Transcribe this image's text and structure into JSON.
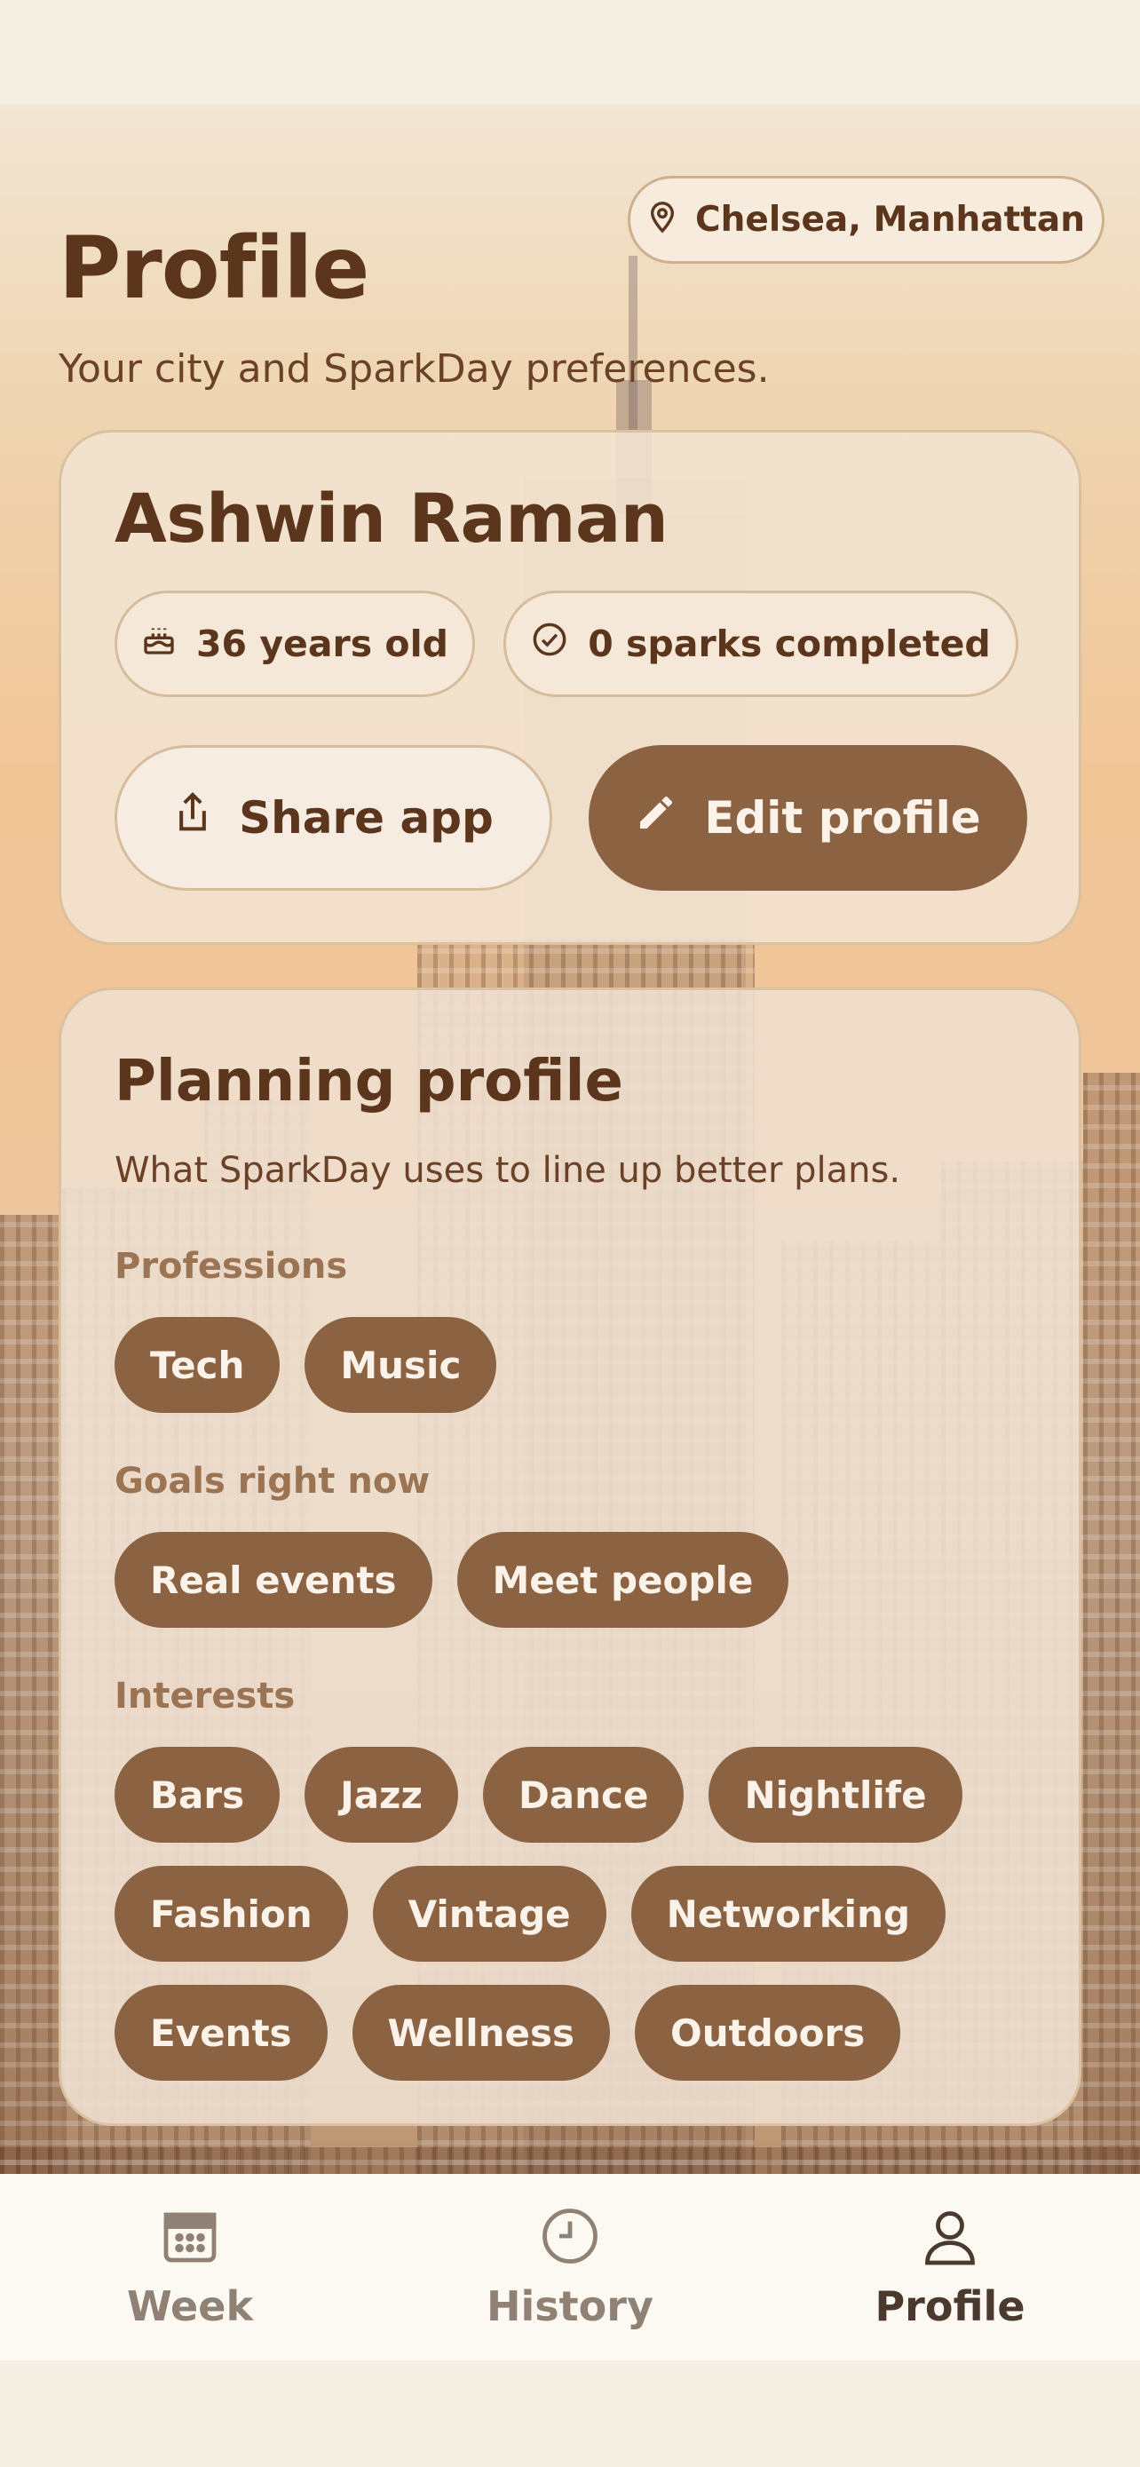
{
  "header": {
    "title": "Profile",
    "subtitle": "Your city and SparkDay preferences.",
    "location": "Chelsea, Manhattan"
  },
  "user": {
    "name": "Ashwin Raman",
    "age_label": "36 years old",
    "sparks_label": "0 sparks completed",
    "share_label": "Share app",
    "edit_label": "Edit profile"
  },
  "planning": {
    "title": "Planning profile",
    "subtitle": "What SparkDay uses to line up better plans.",
    "professions_label": "Professions",
    "professions": [
      "Tech",
      "Music"
    ],
    "goals_label": "Goals right now",
    "goals": [
      "Real events",
      "Meet people"
    ],
    "interests_label": "Interests",
    "interests": [
      "Bars",
      "Jazz",
      "Dance",
      "Nightlife",
      "Fashion",
      "Vintage",
      "Networking",
      "Events",
      "Wellness",
      "Outdoors"
    ]
  },
  "tabs": [
    {
      "label": "Week",
      "icon": "calendar-icon",
      "active": false
    },
    {
      "label": "History",
      "icon": "clock-icon",
      "active": false
    },
    {
      "label": "Profile",
      "icon": "person-icon",
      "active": true
    }
  ],
  "colors": {
    "accent": "#8b6343",
    "text": "#5b351c",
    "muted_label": "#9b7454"
  }
}
